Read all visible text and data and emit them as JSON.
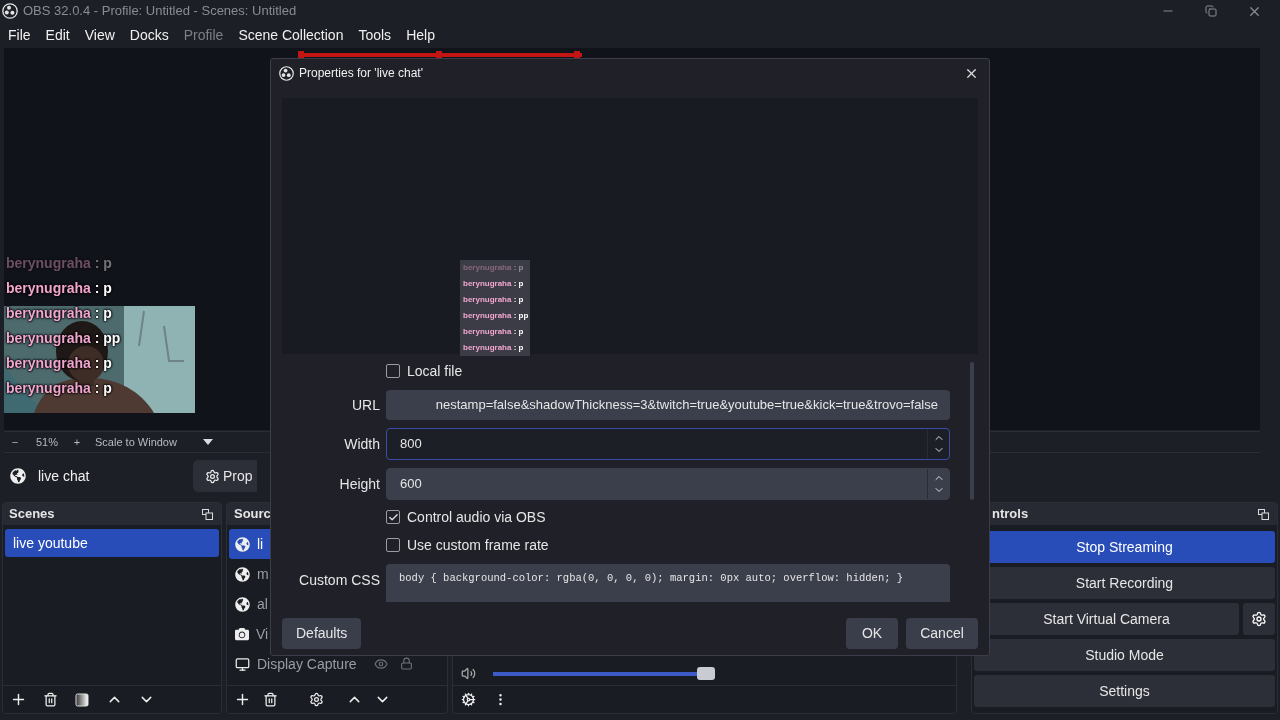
{
  "window": {
    "title": "OBS 32.0.4 - Profile: Untitled - Scenes: Untitled"
  },
  "menu": [
    {
      "label": "File",
      "disabled": false
    },
    {
      "label": "Edit",
      "disabled": false
    },
    {
      "label": "View",
      "disabled": false
    },
    {
      "label": "Docks",
      "disabled": false
    },
    {
      "label": "Profile",
      "disabled": true
    },
    {
      "label": "Scene Collection",
      "disabled": false
    },
    {
      "label": "Tools",
      "disabled": false
    },
    {
      "label": "Help",
      "disabled": false
    }
  ],
  "preview": {
    "chat": [
      {
        "user": "berynugraha",
        "text": ": p",
        "faded": true
      },
      {
        "user": "berynugraha",
        "text": ": p",
        "faded": false
      },
      {
        "user": "berynugraha",
        "text": ": p",
        "faded": false
      },
      {
        "user": "berynugraha",
        "text": ": pp",
        "faded": false
      },
      {
        "user": "berynugraha",
        "text": ": p",
        "faded": false
      },
      {
        "user": "berynugraha",
        "text": ": p",
        "faded": false
      }
    ]
  },
  "zoom_bar": {
    "minus": "−",
    "zoom": "51%",
    "plus": "+",
    "scale": "Scale to Window"
  },
  "source_toolbar": {
    "source": "live chat",
    "properties": "Prop"
  },
  "scenes": {
    "title": "Scenes",
    "items": [
      {
        "label": "live youtube",
        "selected": true
      }
    ]
  },
  "sources": {
    "title": "Sourc",
    "items": [
      {
        "label": "li",
        "kind": "browser",
        "selected": true
      },
      {
        "label": "m",
        "kind": "browser",
        "selected": false
      },
      {
        "label": "al",
        "kind": "browser",
        "selected": false
      },
      {
        "label": "Vi",
        "kind": "camera",
        "selected": false
      },
      {
        "label": "Display Capture",
        "kind": "display",
        "selected": false
      }
    ]
  },
  "mixer": {
    "level": 0.96
  },
  "controls": {
    "title": "ntrols",
    "buttons": [
      {
        "label": "Stop Streaming",
        "active": true,
        "has_settings": false
      },
      {
        "label": "Start Recording",
        "active": false,
        "has_settings": false
      },
      {
        "label": "Start Virtual Camera",
        "active": false,
        "has_settings": true
      },
      {
        "label": "Studio Mode",
        "active": false,
        "has_settings": false
      },
      {
        "label": "Settings",
        "active": false,
        "has_settings": false
      }
    ]
  },
  "dialog": {
    "title": "Properties for 'live chat'",
    "preview_chat": [
      {
        "user": "berynugraha",
        "text": ": p",
        "faded": true
      },
      {
        "user": "berynugraha",
        "text": ": p",
        "faded": false
      },
      {
        "user": "berynugraha",
        "text": ": p",
        "faded": false
      },
      {
        "user": "berynugraha",
        "text": ": pp",
        "faded": false
      },
      {
        "user": "berynugraha",
        "text": ": p",
        "faded": false
      },
      {
        "user": "berynugraha",
        "text": ": p",
        "faded": false
      }
    ],
    "rows": [
      {
        "kind": "checkbox",
        "label": "Local file",
        "checked": false
      },
      {
        "kind": "text",
        "label": "URL",
        "value": "nestamp=false&shadowThickness=3&twitch=true&youtube=true&kick=true&trovo=false"
      },
      {
        "kind": "spin",
        "label": "Width",
        "value": "800",
        "focused": true
      },
      {
        "kind": "spin",
        "label": "Height",
        "value": "600",
        "focused": false
      },
      {
        "kind": "checkbox",
        "label": "Control audio via OBS",
        "checked": true
      },
      {
        "kind": "checkbox",
        "label": "Use custom frame rate",
        "checked": false
      },
      {
        "kind": "code",
        "label": "Custom CSS",
        "value": "body { background-color: rgba(0, 0, 0, 0); margin: 0px auto; overflow: hidden; }"
      }
    ],
    "defaults": "Defaults",
    "ok": "OK",
    "cancel": "Cancel"
  }
}
